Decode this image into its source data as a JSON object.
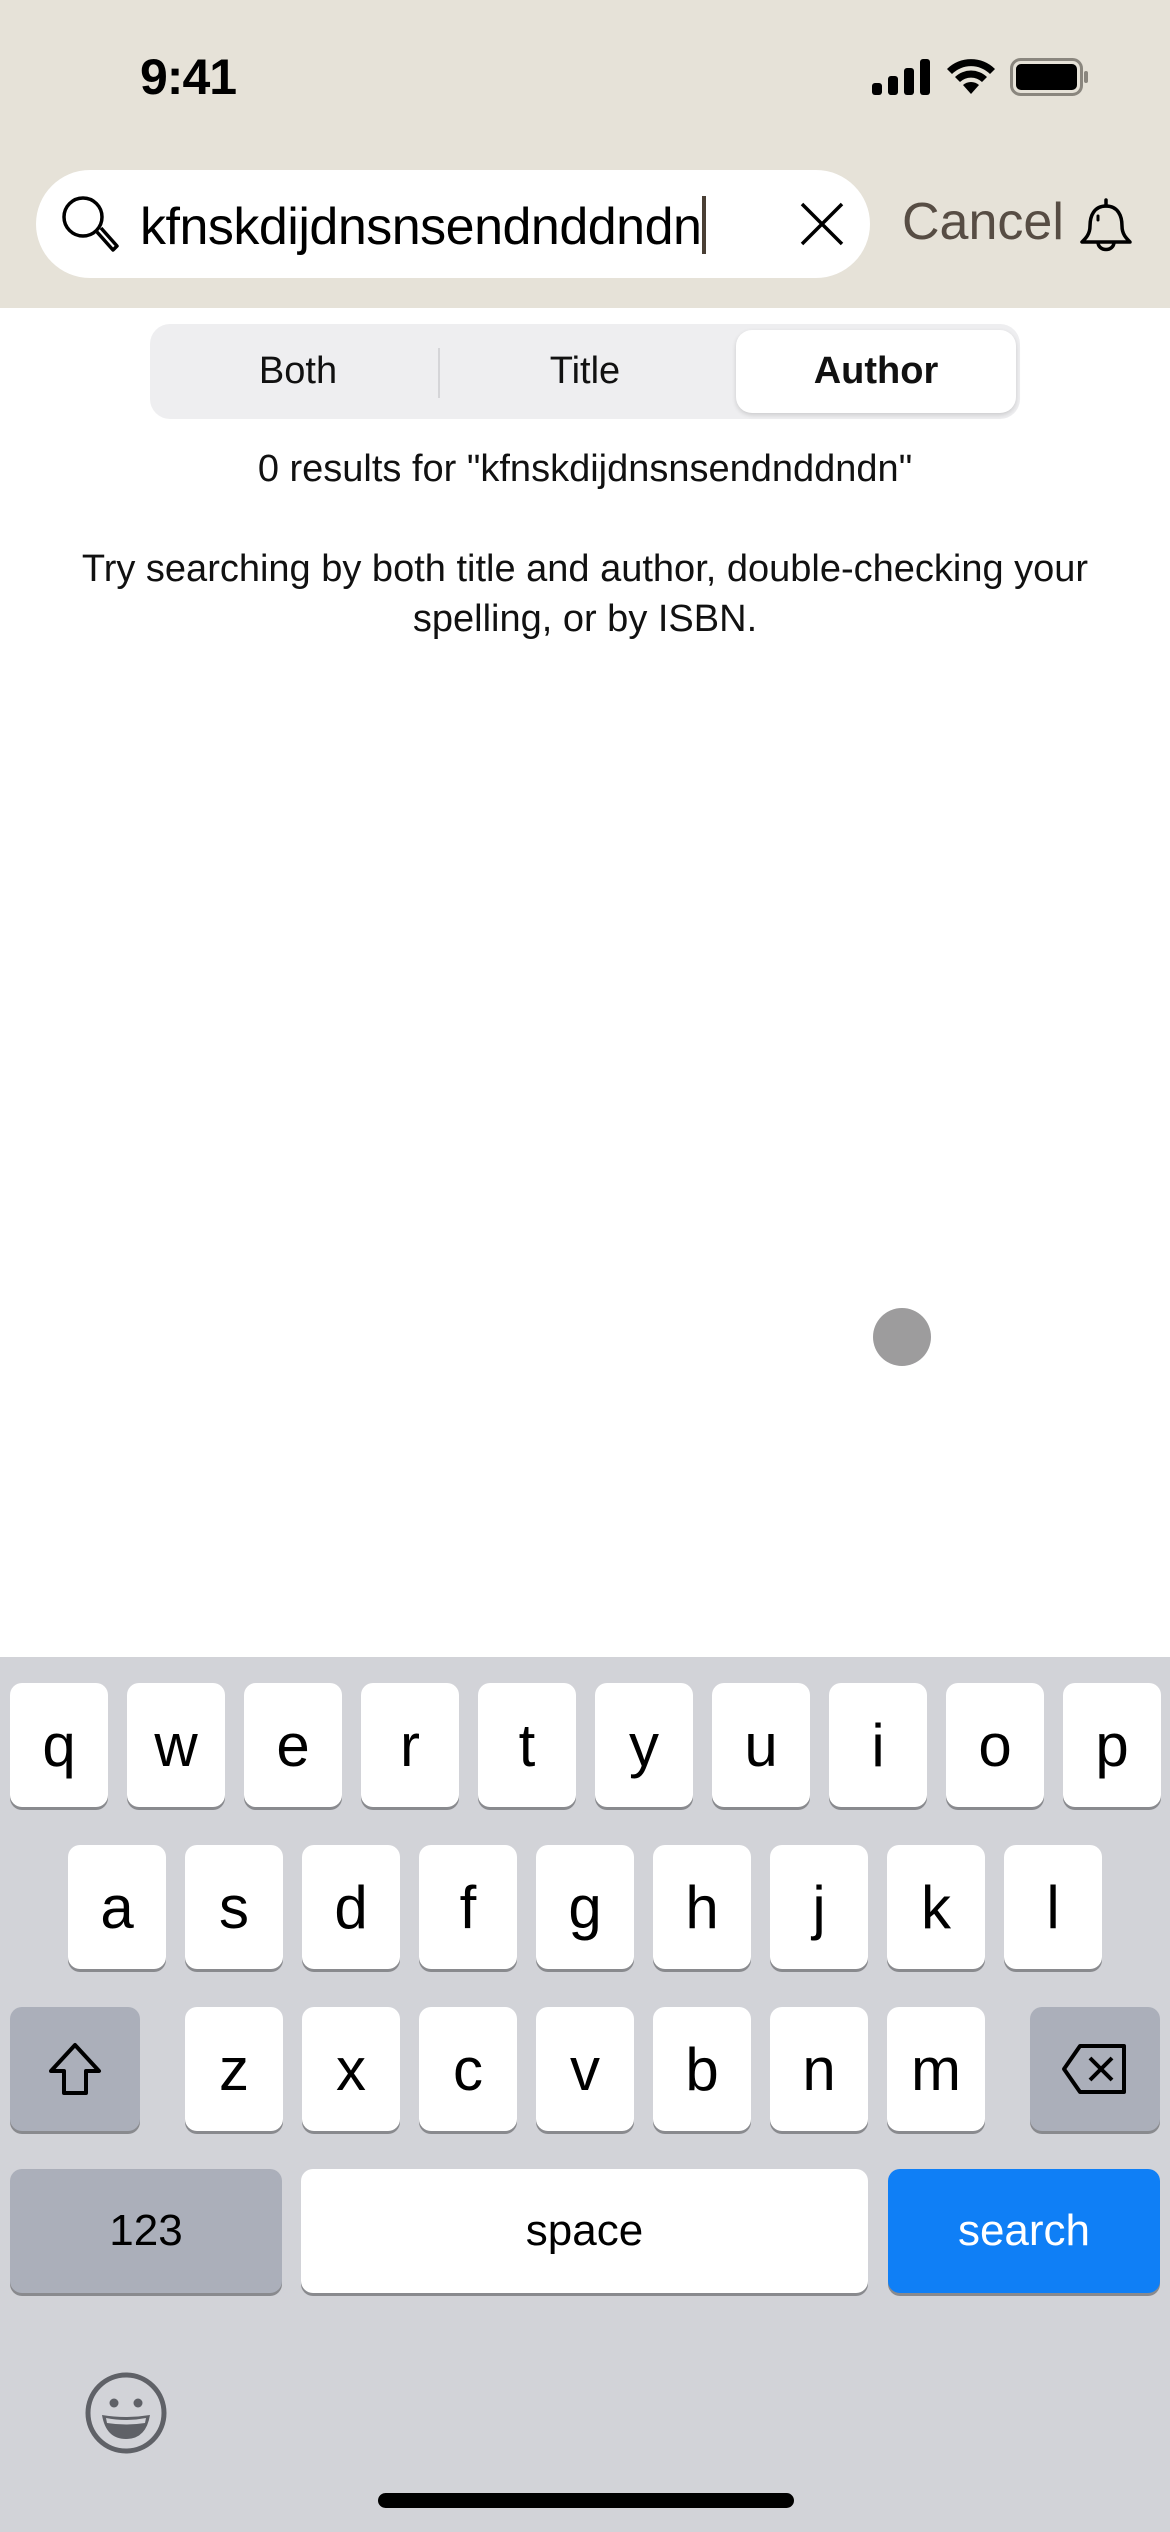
{
  "status_bar": {
    "time": "9:41"
  },
  "search": {
    "query": "kfnskdijdnsnsendnddndn",
    "cancel_label": "Cancel"
  },
  "scope": {
    "options": [
      "Both",
      "Title",
      "Author"
    ],
    "selected": "Author"
  },
  "results": {
    "summary": "0 results for \"kfnskdijdnsnsendnddndn\"",
    "hint": "Try searching by both title and author, double-checking your spelling, or by ISBN."
  },
  "keyboard": {
    "row1": [
      "q",
      "w",
      "e",
      "r",
      "t",
      "y",
      "u",
      "i",
      "o",
      "p"
    ],
    "row2": [
      "a",
      "s",
      "d",
      "f",
      "g",
      "h",
      "j",
      "k",
      "l"
    ],
    "row3": [
      "z",
      "x",
      "c",
      "v",
      "b",
      "n",
      "m"
    ],
    "numbers_label": "123",
    "space_label": "space",
    "return_label": "search",
    "return_color": "#0f7ff6"
  }
}
